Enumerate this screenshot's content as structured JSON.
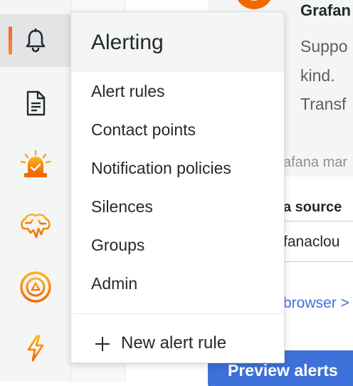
{
  "background": {
    "card_title": "Grafan",
    "card_desc_lines": [
      "Suppo",
      "kind.",
      "Transf"
    ],
    "subtext": "afana mar",
    "field_label": "a source",
    "field_value": "fanaclou",
    "link_text": "browser >",
    "button_label": "Preview alerts"
  },
  "sidebar": {
    "items": [
      {
        "icon": "bell-icon",
        "active": true
      },
      {
        "icon": "document-icon",
        "active": false
      },
      {
        "icon": "siren-icon",
        "active": false
      },
      {
        "icon": "brain-icon",
        "active": false
      },
      {
        "icon": "target-icon",
        "active": false
      },
      {
        "icon": "lightning-icon",
        "active": false
      }
    ]
  },
  "menu": {
    "title": "Alerting",
    "items": [
      {
        "label": "Alert rules"
      },
      {
        "label": "Contact points"
      },
      {
        "label": "Notification policies"
      },
      {
        "label": "Silences"
      },
      {
        "label": "Groups"
      },
      {
        "label": "Admin"
      }
    ],
    "new_item": {
      "icon": "plus-icon",
      "label": "New alert rule"
    }
  },
  "colors": {
    "accent": "#ff8833",
    "accent_red": "#f55f3e",
    "primary_blue": "#3d71d9"
  }
}
